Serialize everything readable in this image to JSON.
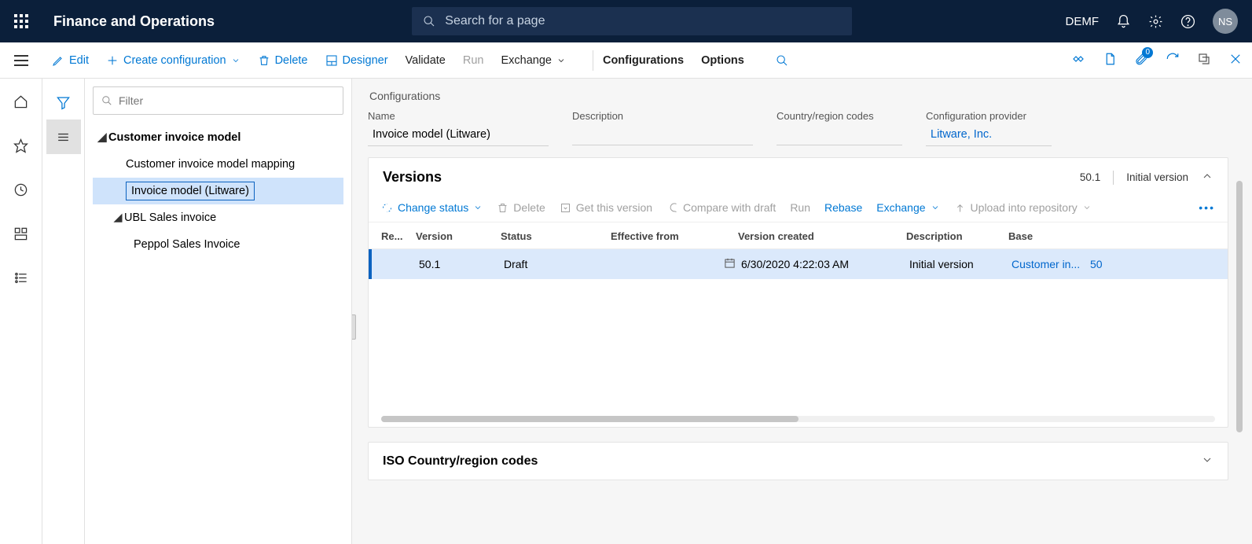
{
  "header": {
    "app_title": "Finance and Operations",
    "search_placeholder": "Search for a page",
    "company": "DEMF",
    "user_initials": "NS"
  },
  "toolbar": {
    "edit": "Edit",
    "create": "Create configuration",
    "delete": "Delete",
    "designer": "Designer",
    "validate": "Validate",
    "run": "Run",
    "exchange": "Exchange",
    "configurations": "Configurations",
    "options": "Options",
    "attach_badge": "0"
  },
  "tree": {
    "filter_placeholder": "Filter",
    "root": "Customer invoice model",
    "items": [
      {
        "label": "Customer invoice model mapping",
        "level": 2
      },
      {
        "label": "Invoice model (Litware)",
        "level": 2,
        "selected": true
      },
      {
        "label": "UBL Sales invoice",
        "level": 2,
        "expandable": true
      },
      {
        "label": "Peppol Sales Invoice",
        "level": 3
      }
    ]
  },
  "page": {
    "breadcrumb": "Configurations",
    "fields": {
      "name_label": "Name",
      "name_value": "Invoice model (Litware)",
      "desc_label": "Description",
      "desc_value": "",
      "country_label": "Country/region codes",
      "country_value": "",
      "provider_label": "Configuration provider",
      "provider_value": "Litware, Inc."
    },
    "versions": {
      "title": "Versions",
      "meta_version": "50.1",
      "meta_desc": "Initial version",
      "actions": {
        "change_status": "Change status",
        "delete": "Delete",
        "get": "Get this version",
        "compare": "Compare with draft",
        "run": "Run",
        "rebase": "Rebase",
        "exchange": "Exchange",
        "upload": "Upload into repository"
      },
      "columns": {
        "re": "Re...",
        "version": "Version",
        "status": "Status",
        "effective": "Effective from",
        "created": "Version created",
        "desc": "Description",
        "base": "Base"
      },
      "row": {
        "version": "50.1",
        "status": "Draft",
        "created": "6/30/2020 4:22:03 AM",
        "desc": "Initial version",
        "base_name": "Customer in...",
        "base_num": "50"
      }
    },
    "iso_title": "ISO Country/region codes"
  }
}
